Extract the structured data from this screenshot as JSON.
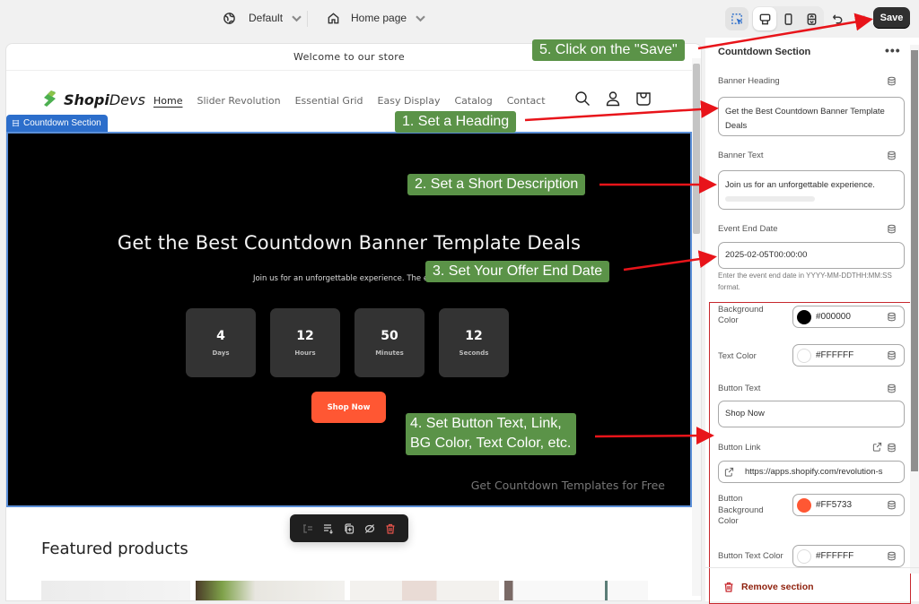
{
  "topbar": {
    "theme_select": "Default",
    "page_select": "Home page",
    "save_label": "Save",
    "tools": [
      "inspect-icon",
      "desktop-icon",
      "mobile-icon",
      "fullwidth-icon",
      "undo-icon",
      "redo-icon"
    ]
  },
  "store": {
    "announcement": "Welcome to our store",
    "logo": {
      "bold": "Shopi",
      "light": "Devs"
    },
    "nav": [
      "Home",
      "Slider Revolution",
      "Essential Grid",
      "Easy Display",
      "Catalog",
      "Contact"
    ],
    "active_nav": "Home",
    "section_tag": "Countdown Section",
    "banner": {
      "heading": "Get the Best Countdown Banner Template Deals",
      "text": "Join us for an unforgettable experience. The event",
      "timer": [
        {
          "value": "4",
          "label": "Days"
        },
        {
          "value": "12",
          "label": "Hours"
        },
        {
          "value": "50",
          "label": "Minutes"
        },
        {
          "value": "12",
          "label": "Seconds"
        }
      ],
      "button": "Shop Now",
      "footer": "Get Countdown Templates for Free",
      "background": "#000000",
      "button_color": "#FF5733"
    },
    "featured_title": "Featured products"
  },
  "panel": {
    "title": "Countdown Section",
    "more": "•••",
    "banner_heading": {
      "label": "Banner Heading",
      "value": "Get the Best Countdown Banner Template Deals"
    },
    "banner_text": {
      "label": "Banner Text",
      "value": "Join us for an unforgettable experience."
    },
    "event_end": {
      "label": "Event End Date",
      "value": "2025-02-05T00:00:00",
      "help": "Enter the event end date in YYYY-MM-DDTHH:MM:SS format."
    },
    "bg_color": {
      "label": "Background Color",
      "value": "#000000"
    },
    "text_color": {
      "label": "Text Color",
      "value": "#FFFFFF"
    },
    "button_text": {
      "label": "Button Text",
      "value": "Shop Now"
    },
    "button_link": {
      "label": "Button Link",
      "value": "https://apps.shopify.com/revolution-s"
    },
    "button_bg": {
      "label": "Button Background Color",
      "value": "#FF5733"
    },
    "button_text_color": {
      "label": "Button Text Color",
      "value": "#FFFFFF"
    },
    "remove": "Remove section"
  },
  "callouts": {
    "c1": "1. Set a Heading",
    "c2": "2. Set a Short Description",
    "c3": "3. Set Your Offer End Date",
    "c4a": "4. Set Button Text, Link,",
    "c4b": "BG Color, Text Color, etc.",
    "c5": "5. Click on the \"Save\""
  }
}
